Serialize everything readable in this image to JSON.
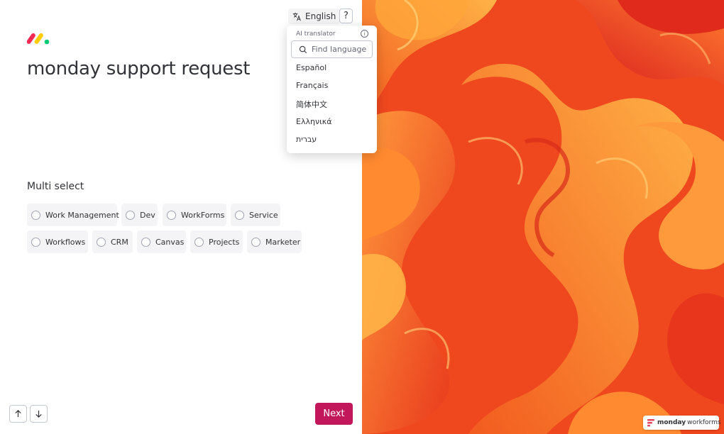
{
  "page": {
    "title": "monday support request"
  },
  "language": {
    "current": "English",
    "help": "?"
  },
  "translator": {
    "header": "AI translator",
    "info": "i",
    "search_placeholder": "Find language",
    "options": [
      "Español",
      "Français",
      "简体中文",
      "Ελληνικά",
      "עברית"
    ]
  },
  "question": {
    "label": "Multi select",
    "options": [
      "Work Management",
      "Dev",
      "WorkForms",
      "Service",
      "Workflows",
      "CRM",
      "Canvas",
      "Projects",
      "Marketer"
    ]
  },
  "nav": {
    "next_label": "Next",
    "up_icon": "arrow-up-icon",
    "down_icon": "arrow-down-icon"
  },
  "branding": {
    "name": "monday",
    "product": "workforms"
  },
  "colors": {
    "accent": "#c2185b",
    "logo_red": "#f62b54",
    "logo_yellow": "#ffcc00",
    "logo_green": "#00ca72"
  }
}
